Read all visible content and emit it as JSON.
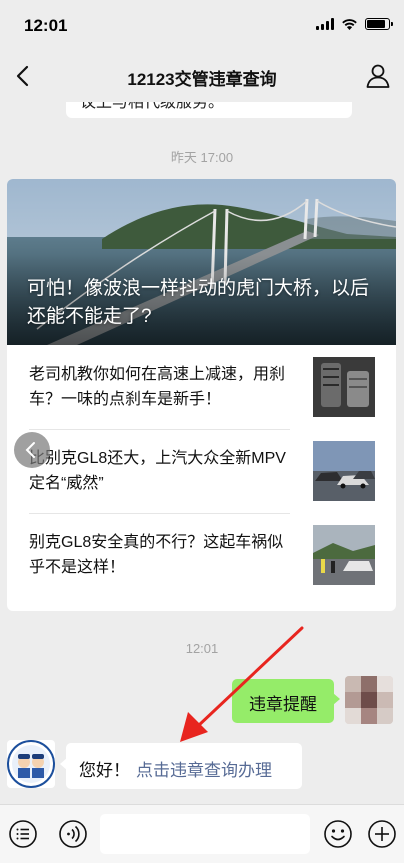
{
  "status_bar": {
    "time": "12:01",
    "battery_level": 0.85
  },
  "nav": {
    "title": "12123交管违章查询",
    "back_icon": "chevron-left-icon",
    "profile_icon": "person-icon"
  },
  "chat": {
    "previous_bubble_text": "议上与相代级服务。",
    "timestamp_1": "昨天 17:00",
    "card": {
      "hero_title": "可怕！像波浪一样抖动的虎门大桥，以后还能不能走了?",
      "items": [
        {
          "title": "老司机教你如何在高速上减速，用刹车？一味的点刹车是新手！"
        },
        {
          "title": "比别克GL8还大，上汽大众全新MPV定名“威然”"
        },
        {
          "title": "别克GL8安全真的不行？这起车祸似乎不是这样！"
        }
      ]
    },
    "timestamp_2": "12:01",
    "user_message": "违章提醒",
    "bot_message": {
      "greeting": "您好！",
      "link": "点击违章查询办理"
    }
  },
  "input_bar": {
    "voice_icon": "voice-list-icon",
    "audio_icon": "audio-icon",
    "emoji_icon": "emoji-icon",
    "add_icon": "plus-circle-icon"
  },
  "colors": {
    "background": "#ededed",
    "user_bubble": "#95ec69",
    "link": "#576b95",
    "annotation_arrow": "#e8251f"
  }
}
